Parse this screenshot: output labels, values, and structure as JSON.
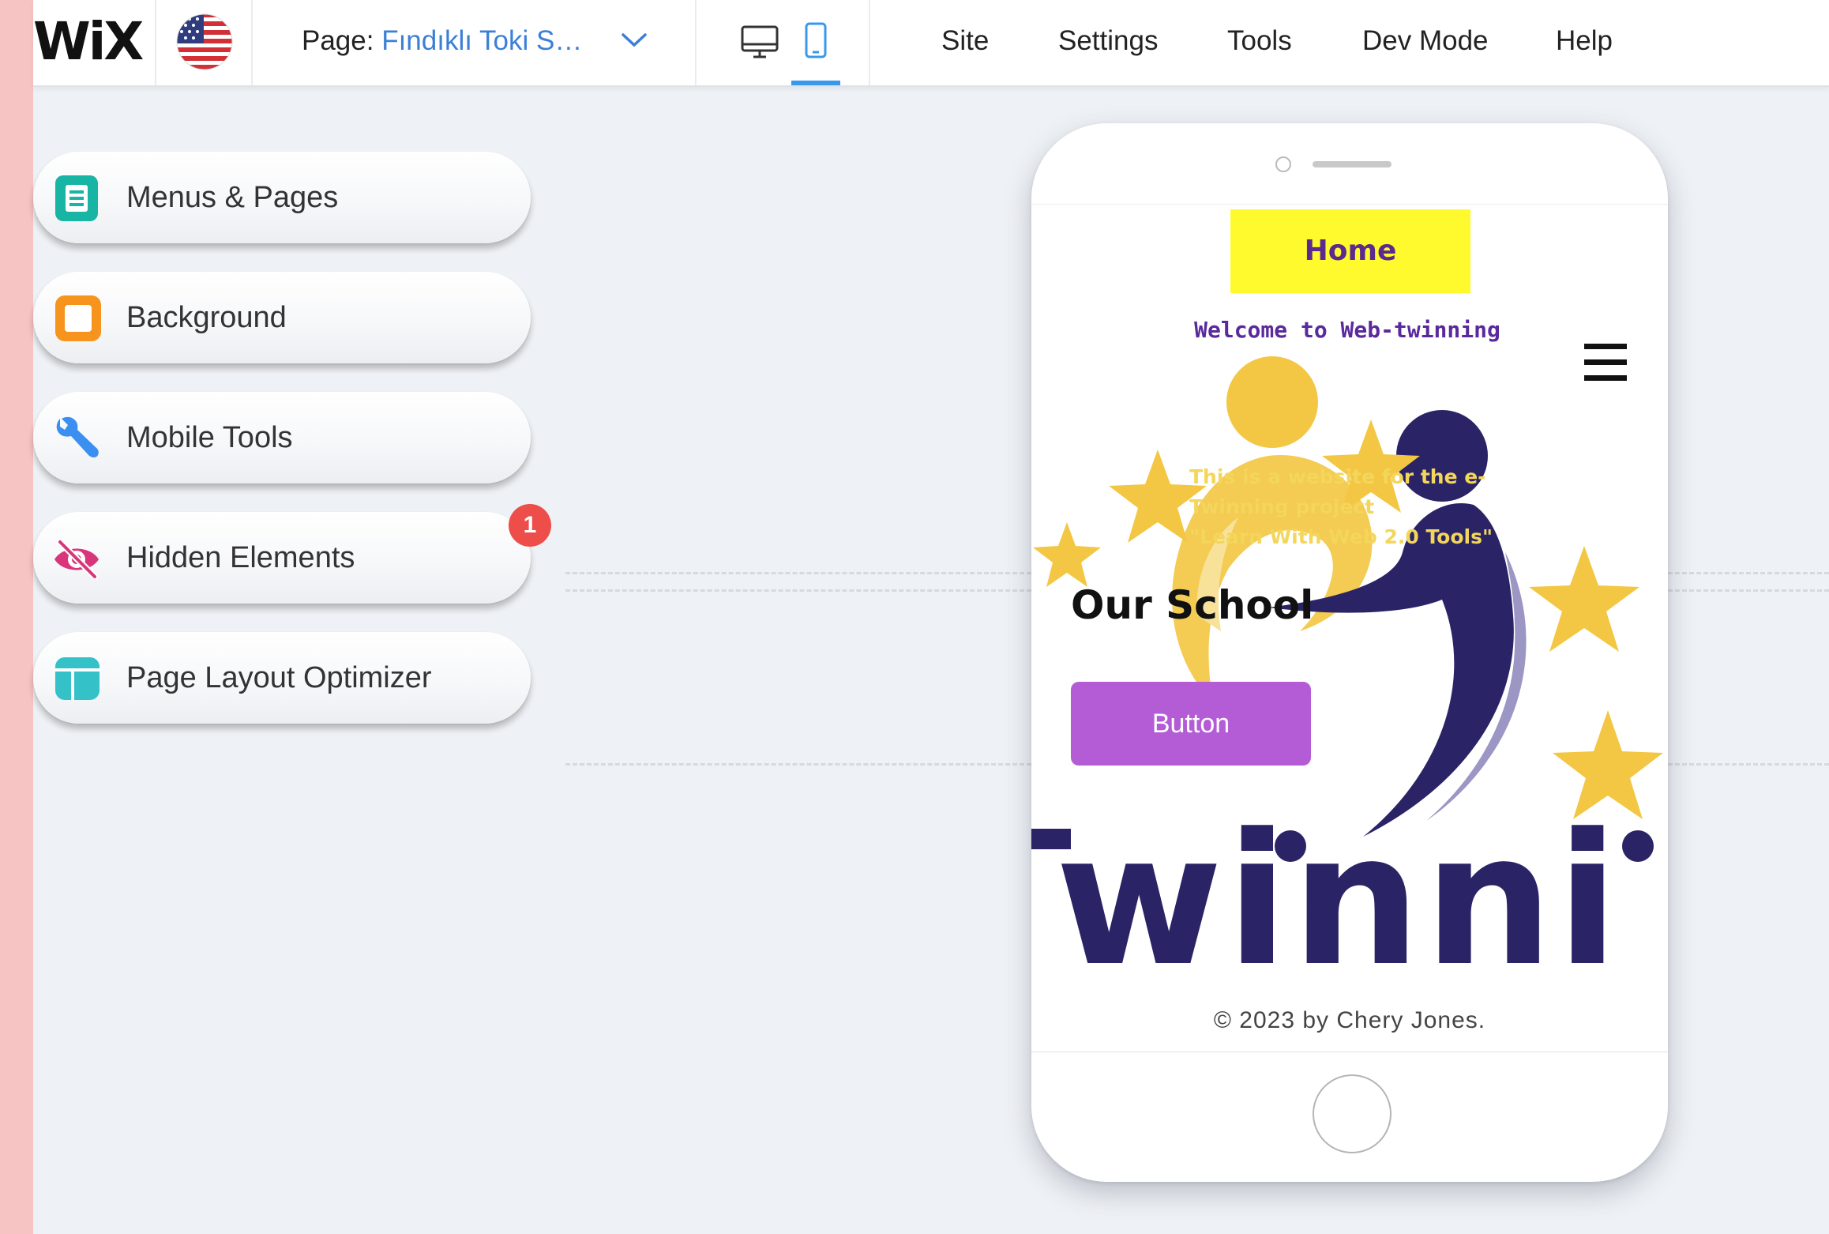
{
  "topbar": {
    "logo": "WiX",
    "flag_icon": "us-flag-icon",
    "page_prefix": "Page:",
    "page_name": "Fındıklı Toki S…",
    "menu": [
      "Site",
      "Settings",
      "Tools",
      "Dev Mode",
      "Help"
    ],
    "accent_color": "#3899ec"
  },
  "tools": [
    {
      "label": "Menus & Pages",
      "icon": "menus-pages-icon",
      "color": "#18b4a4"
    },
    {
      "label": "Background",
      "icon": "background-icon",
      "color": "#f7941d"
    },
    {
      "label": "Mobile Tools",
      "icon": "wrench-icon",
      "color": "#3b8ff0"
    },
    {
      "label": "Hidden Elements",
      "icon": "hidden-eye-icon",
      "color": "#d8357a",
      "badge": "1"
    },
    {
      "label": "Page Layout Optimizer",
      "icon": "layout-optimizer-icon",
      "color": "#35c1c8"
    }
  ],
  "phone": {
    "nav_home": "Home",
    "welcome": "Welcome to Web-twinning",
    "description": [
      "This is a website for the e-",
      "Twinning project",
      "\"Learn With Web 2.0 Tools\""
    ],
    "heading": "Our School",
    "button": "Button",
    "logo_text": "winni",
    "copyright": "© 2023 by Chery Jones."
  }
}
